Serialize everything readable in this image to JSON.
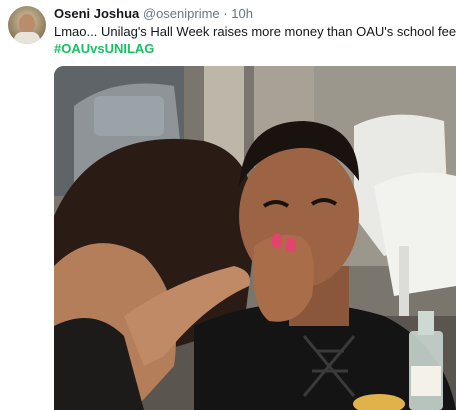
{
  "tweet": {
    "display_name": "Oseni Joshua",
    "handle": "@oseniprime",
    "separator": "·",
    "time": "10h",
    "text": "Lmao... Unilag's Hall Week raises more money than OAU's school fees",
    "hashtag": "#OAUvsUNILAG"
  },
  "colors": {
    "name": "#14171a",
    "meta": "#657786",
    "hashtag": "#17bf63"
  },
  "media": {
    "type": "photo"
  }
}
